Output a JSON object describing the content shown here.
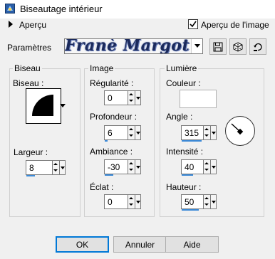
{
  "window": {
    "title": "Biseautage intérieur"
  },
  "preview": {
    "label": "Aperçu",
    "checkbox_label": "Aperçu de l'image",
    "checked": true
  },
  "presets": {
    "label": "Paramètres",
    "value": "Franè Margot"
  },
  "groups": {
    "biseau": {
      "title": "Biseau",
      "bevel_label": "Biseau :",
      "width_label": "Largeur :",
      "width_value": "8"
    },
    "image": {
      "title": "Image",
      "regularite_label": "Régularité :",
      "regularite_value": "0",
      "profondeur_label": "Profondeur :",
      "profondeur_value": "6",
      "ambiance_label": "Ambiance :",
      "ambiance_value": "-30",
      "eclat_label": "Éclat :",
      "eclat_value": "0"
    },
    "lumiere": {
      "title": "Lumière",
      "couleur_label": "Couleur :",
      "couleur_value": "#ffffff",
      "angle_label": "Angle :",
      "angle_value": "315",
      "intensite_label": "Intensité :",
      "intensite_value": "40",
      "hauteur_label": "Hauteur :",
      "hauteur_value": "50"
    }
  },
  "buttons": {
    "ok": "OK",
    "cancel": "Annuler",
    "help": "Aide"
  },
  "icons": {
    "app": "app-icon",
    "save": "save-icon",
    "random": "dice-icon",
    "reset": "reset-icon"
  },
  "colors": {
    "accent": "#3b8ad8",
    "focus": "#0078d7"
  }
}
